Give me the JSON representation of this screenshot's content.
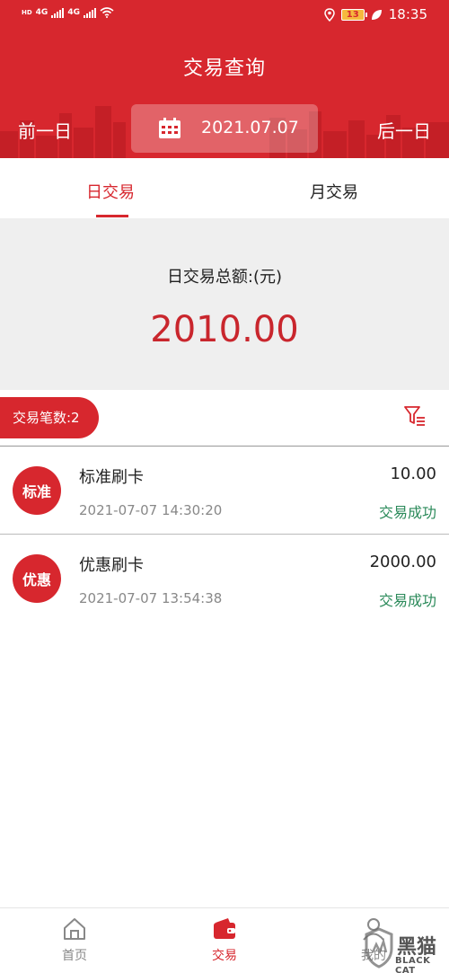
{
  "status_bar": {
    "left_labels": [
      "HD",
      "4G",
      "4G"
    ],
    "battery": "13",
    "time": "18:35",
    "icons": [
      "signal-icon",
      "wifi-icon",
      "location-icon",
      "battery-icon",
      "leaf-icon"
    ]
  },
  "header": {
    "title": "交易查询",
    "prev_day": "前一日",
    "next_day": "后一日",
    "date": "2021.07.07",
    "accent_color": "#d7272e"
  },
  "tabs": [
    {
      "label": "日交易",
      "active": true
    },
    {
      "label": "月交易",
      "active": false
    }
  ],
  "summary": {
    "label": "日交易总额:(元)",
    "amount": "2010.00"
  },
  "count_badge": "交易笔数:2",
  "transactions": [
    {
      "logo": "标准",
      "name": "标准刷卡",
      "time": "2021-07-07 14:30:20",
      "amount": "10.00",
      "status": "交易成功"
    },
    {
      "logo": "优惠",
      "name": "优惠刷卡",
      "time": "2021-07-07 13:54:38",
      "amount": "2000.00",
      "status": "交易成功"
    }
  ],
  "bottom_nav": [
    {
      "label": "首页",
      "icon": "home-icon",
      "active": false
    },
    {
      "label": "交易",
      "icon": "wallet-icon",
      "active": true
    },
    {
      "label": "我的",
      "icon": "user-icon",
      "active": false
    }
  ],
  "watermark": {
    "title": "黑猫",
    "subtitle": "BLACK CAT"
  }
}
